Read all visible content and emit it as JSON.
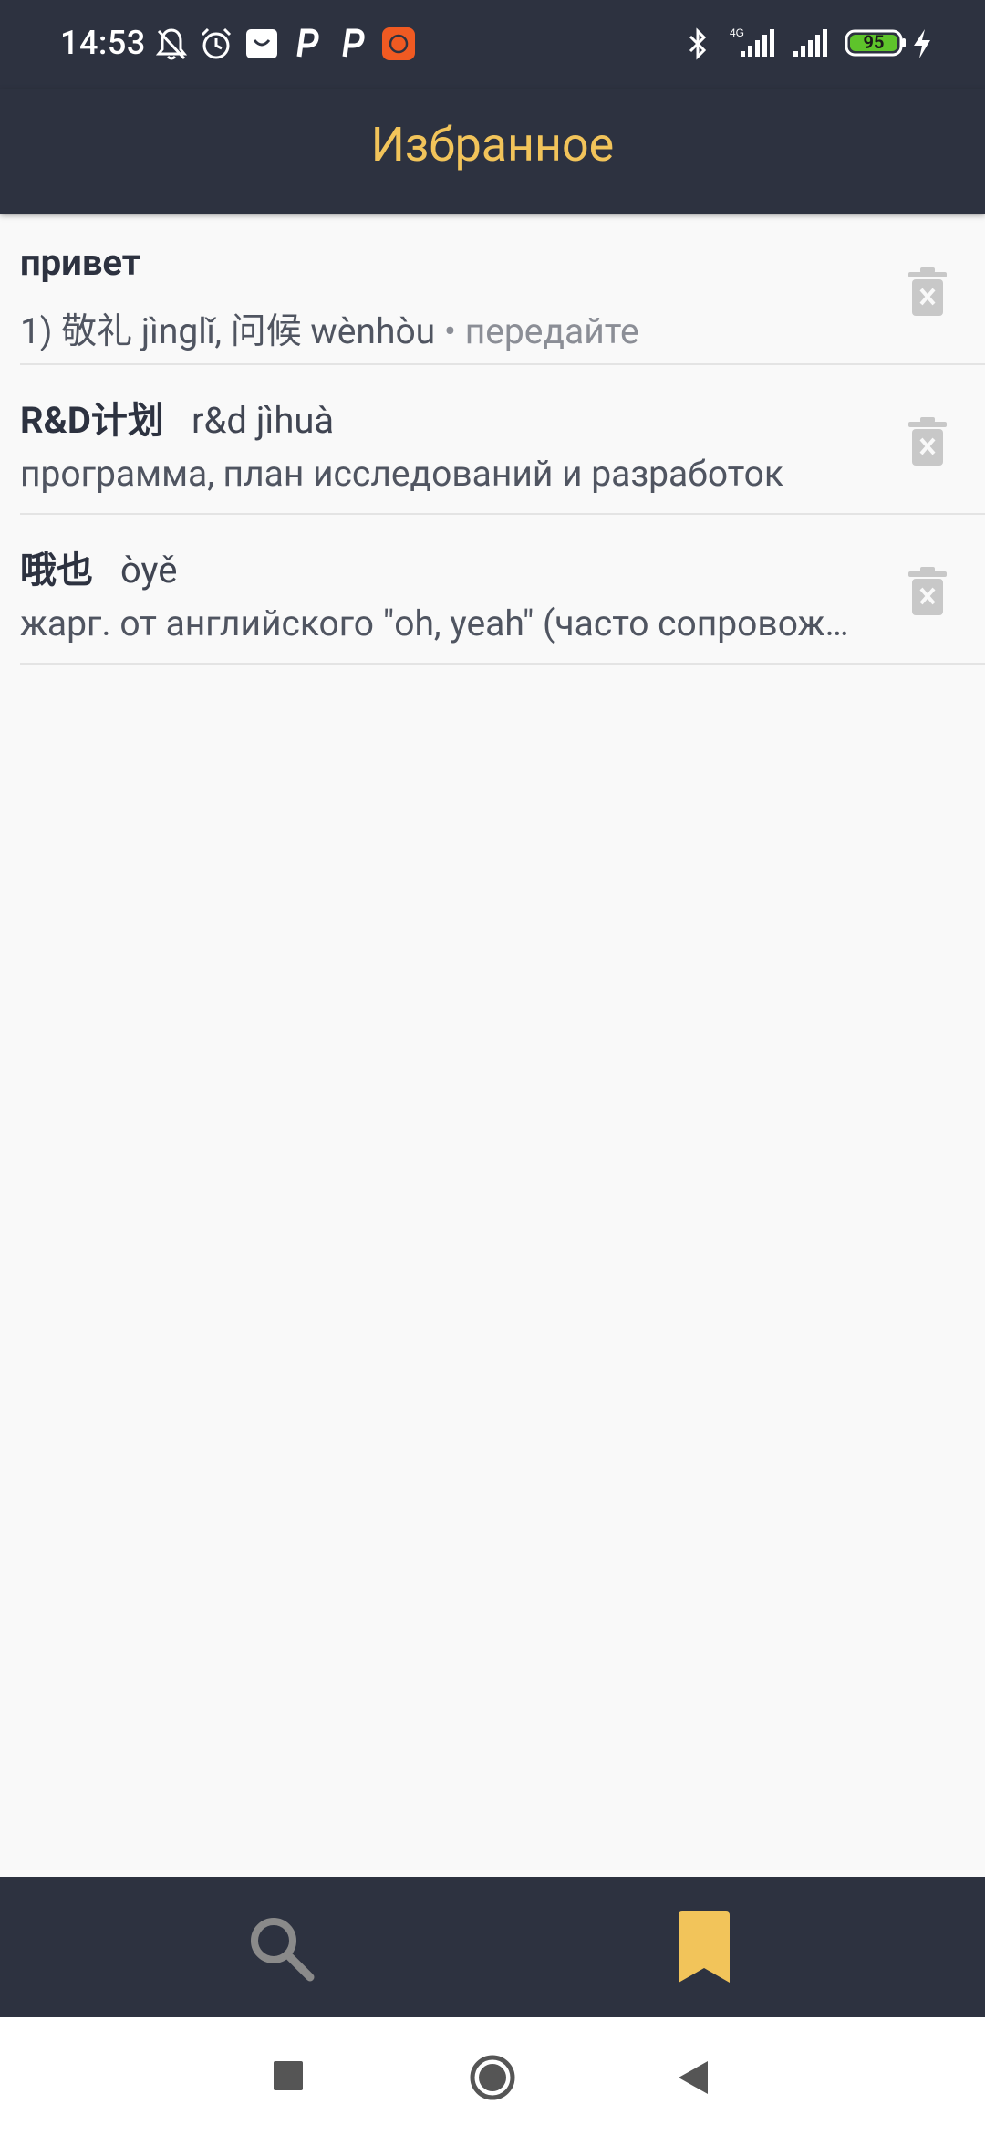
{
  "status_bar": {
    "time": "14:53",
    "battery": "95",
    "network": "4G",
    "icons": [
      "bell-off-icon",
      "alarm-icon",
      "shopping-bag-icon",
      "p-app-icon",
      "p-app-icon",
      "mi-app-icon",
      "bluetooth-icon",
      "signal-icon",
      "signal-icon",
      "battery-icon",
      "charging-icon"
    ]
  },
  "app_bar": {
    "title": "Избранное"
  },
  "favorites": [
    {
      "word": "привет",
      "pinyin": "",
      "definition": "1) 敬礼 jìnglǐ, 问候 wènhòu",
      "extra": " • передайте"
    },
    {
      "word": "R&D计划",
      "pinyin": "r&d jìhuà",
      "definition": "программа, план исследований и разработок",
      "extra": ""
    },
    {
      "word": "哦也",
      "pinyin": "òyě",
      "definition": "жарг. от английского \"oh, yeah\" (часто сопровождается жестом)",
      "extra": ""
    }
  ],
  "bottom_nav": {
    "items": [
      {
        "icon": "search-icon",
        "active": false
      },
      {
        "icon": "bookmark-icon",
        "active": true
      }
    ],
    "active_color": "#f2c45a",
    "inactive_color": "#8a8a8a"
  },
  "system_nav": [
    "recents-square-icon",
    "home-circle-icon",
    "back-triangle-icon"
  ],
  "colors": {
    "bar": "#2d3240",
    "accent": "#f2c45a",
    "background": "#f9f9f9"
  }
}
